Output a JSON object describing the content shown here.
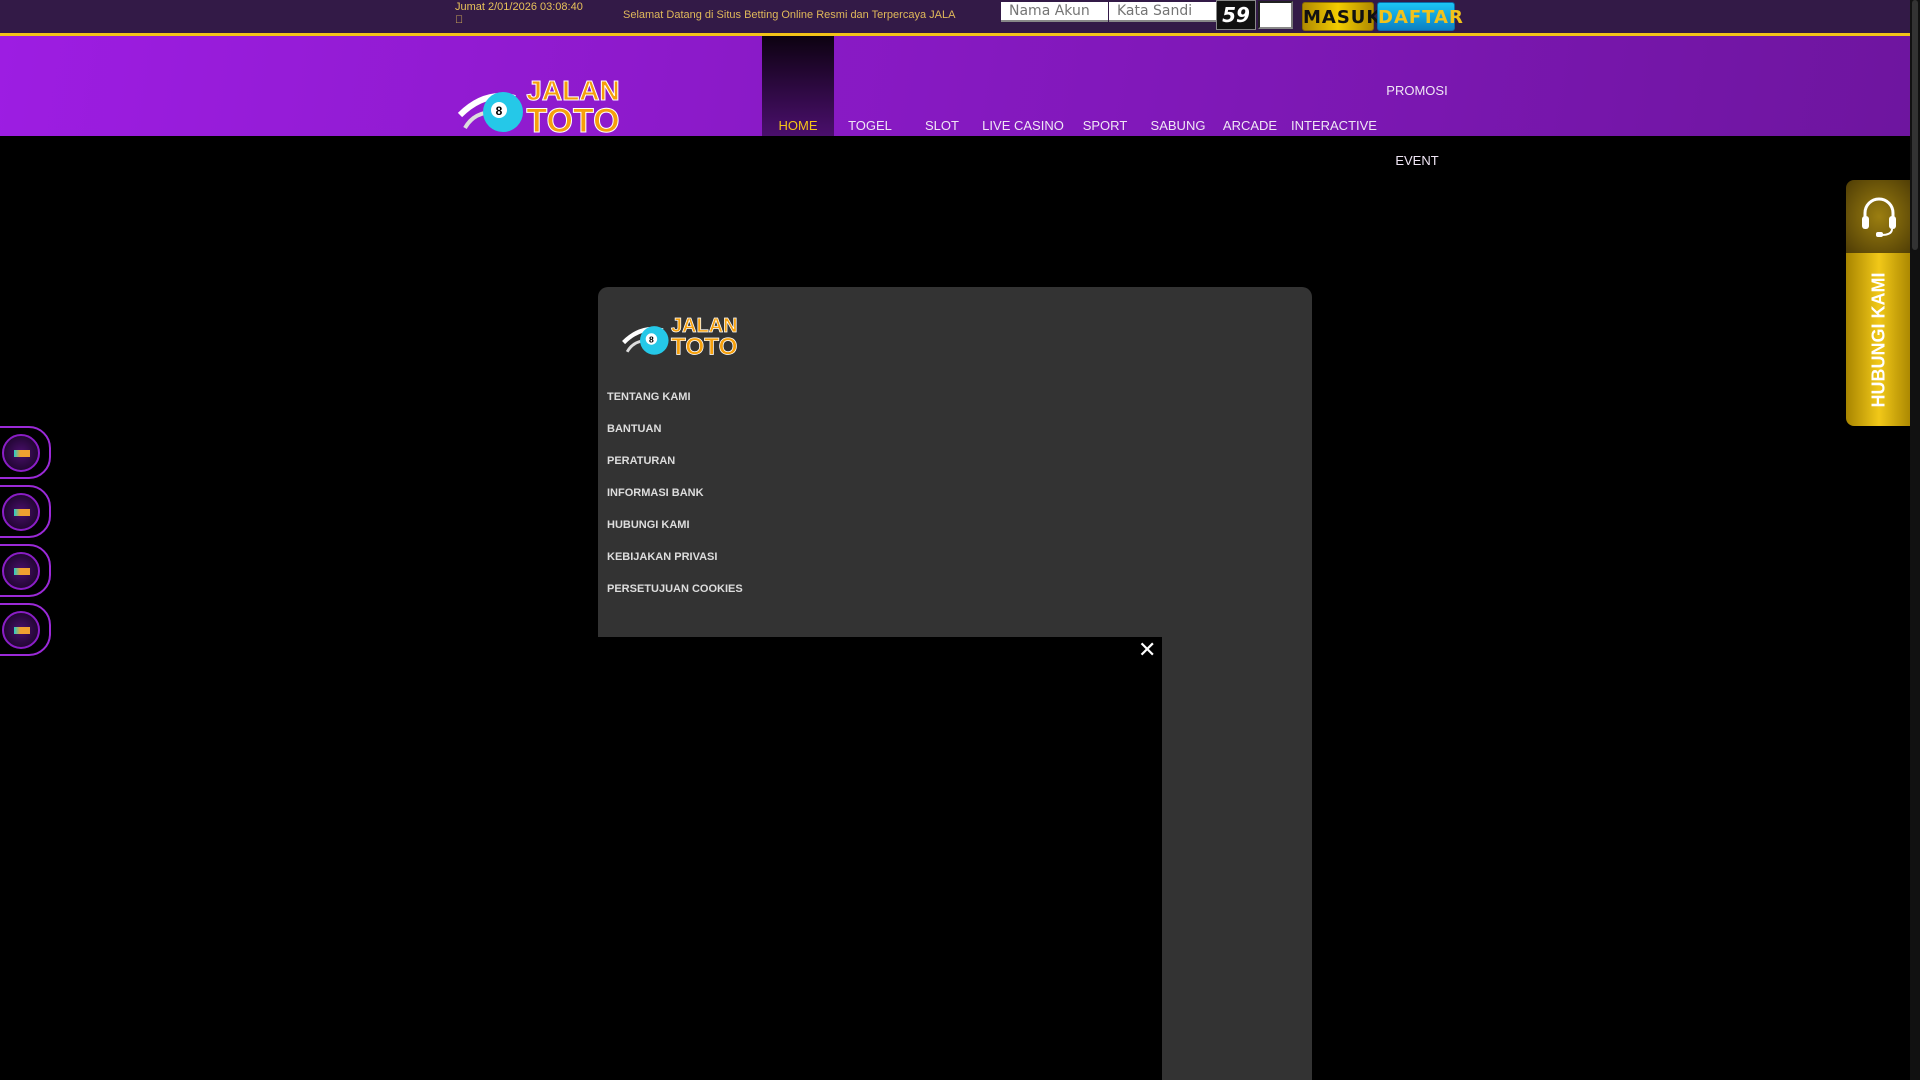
{
  "topbar": {
    "datetime": "Jumat 2/01/2026 03:08:40",
    "icon_glyph": "",
    "marquee": "Selamat Datang di Situs Betting Online Resmi dan Terpercaya JALANTOTO"
  },
  "login": {
    "username_placeholder": "Nama Akun",
    "password_placeholder": "Kata Sandi",
    "captcha": "59",
    "login_label": "MASUK",
    "register_label": "DAFTAR"
  },
  "brand": {
    "logo_line1": "JALAN",
    "logo_line2": "TOTO"
  },
  "nav": [
    {
      "label": "HOME"
    },
    {
      "label": "TOGEL"
    },
    {
      "label": "SLOT"
    },
    {
      "label": "LIVE CASINO"
    },
    {
      "label": "SPORT"
    },
    {
      "label": "SABUNG"
    },
    {
      "label": "ARCADE"
    },
    {
      "label": "INTERACTIVE"
    },
    {
      "label": "PROMOSI"
    },
    {
      "label": "EVENT"
    }
  ],
  "panel": {
    "links": [
      "TENTANG KAMI",
      "BANTUAN",
      "PERATURAN",
      "INFORMASI BANK",
      "HUBUNGI KAMI",
      "KEBIJAKAN PRIVASI",
      "PERSETUJUAN COOKIES"
    ],
    "close": "✕"
  },
  "contact": {
    "label": "HUBUNGI KAMI"
  },
  "colors": {
    "accent": "#f2c318",
    "header": "#8a1bc8"
  }
}
